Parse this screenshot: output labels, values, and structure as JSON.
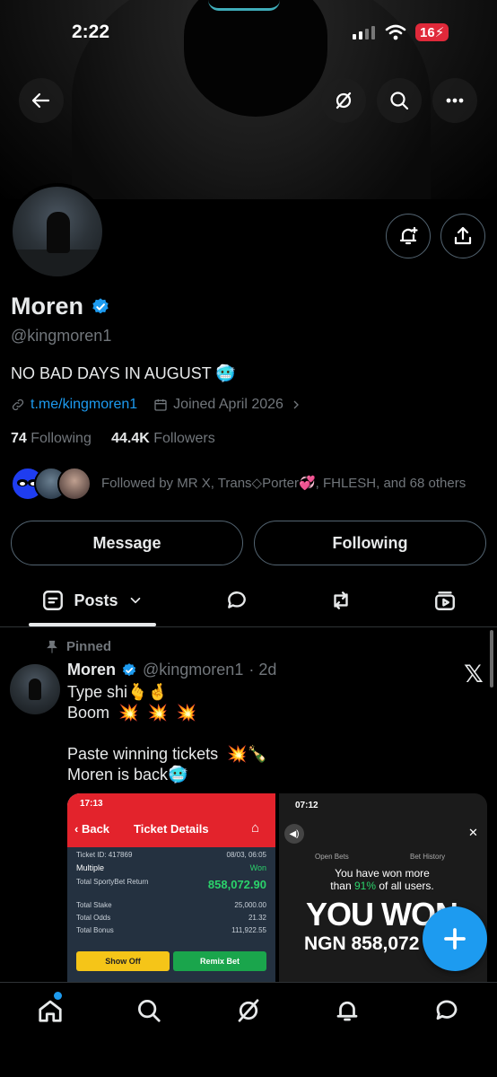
{
  "status_bar": {
    "time": "2:22",
    "battery": "16"
  },
  "profile": {
    "name": "Moren",
    "handle": "@kingmoren1",
    "bio": "NO BAD DAYS IN AUGUST 🥶",
    "link": "t.me/kingmoren1",
    "joined": "Joined April 2026",
    "following_count": "74",
    "following_label": "Following",
    "followers_count": "44.4K",
    "followers_label": "Followers",
    "followed_by": "Followed by MR X, Trans◇Porter💞, FHLESH, and 68 others"
  },
  "actions": {
    "message": "Message",
    "following": "Following"
  },
  "tabs": {
    "posts": "Posts"
  },
  "pinned_post": {
    "pinned_label": "Pinned",
    "author": "Moren",
    "handle": "@kingmoren1",
    "time": "· 2d",
    "text": "Type shi🫰🤞\nBoom  💥  💥  💥\n\nPaste winning tickets  💥🍾\nMoren is back🥶",
    "media1": {
      "time": "17:13",
      "back": "Back",
      "title": "Ticket Details",
      "ticket_id": "Ticket ID: 417869",
      "date": "08/03, 06:05",
      "multiple": "Multiple",
      "won": "Won",
      "return_label": "Total SportyBet Return",
      "return_value": "858,072.90",
      "stake_label": "Total Stake",
      "stake_value": "25,000.00",
      "odds_label": "Total Odds",
      "odds_value": "21.32",
      "bonus_label": "Total Bonus",
      "bonus_value": "111,922.55",
      "show_off": "Show Off",
      "remix": "Remix Bet"
    },
    "media2": {
      "time": "07:12",
      "tab1": "Open Bets",
      "tab2": "Bet History",
      "won_line1": "You have won more",
      "won_line2_pre": "than ",
      "won_pct": "91%",
      "won_line2_post": " of all users.",
      "big": "YOU WON",
      "amount": "NGN 858,072"
    }
  },
  "colors": {
    "accent": "#1d9bf0",
    "muted": "#71767b",
    "text": "#e7e9ea",
    "border": "#536471"
  }
}
